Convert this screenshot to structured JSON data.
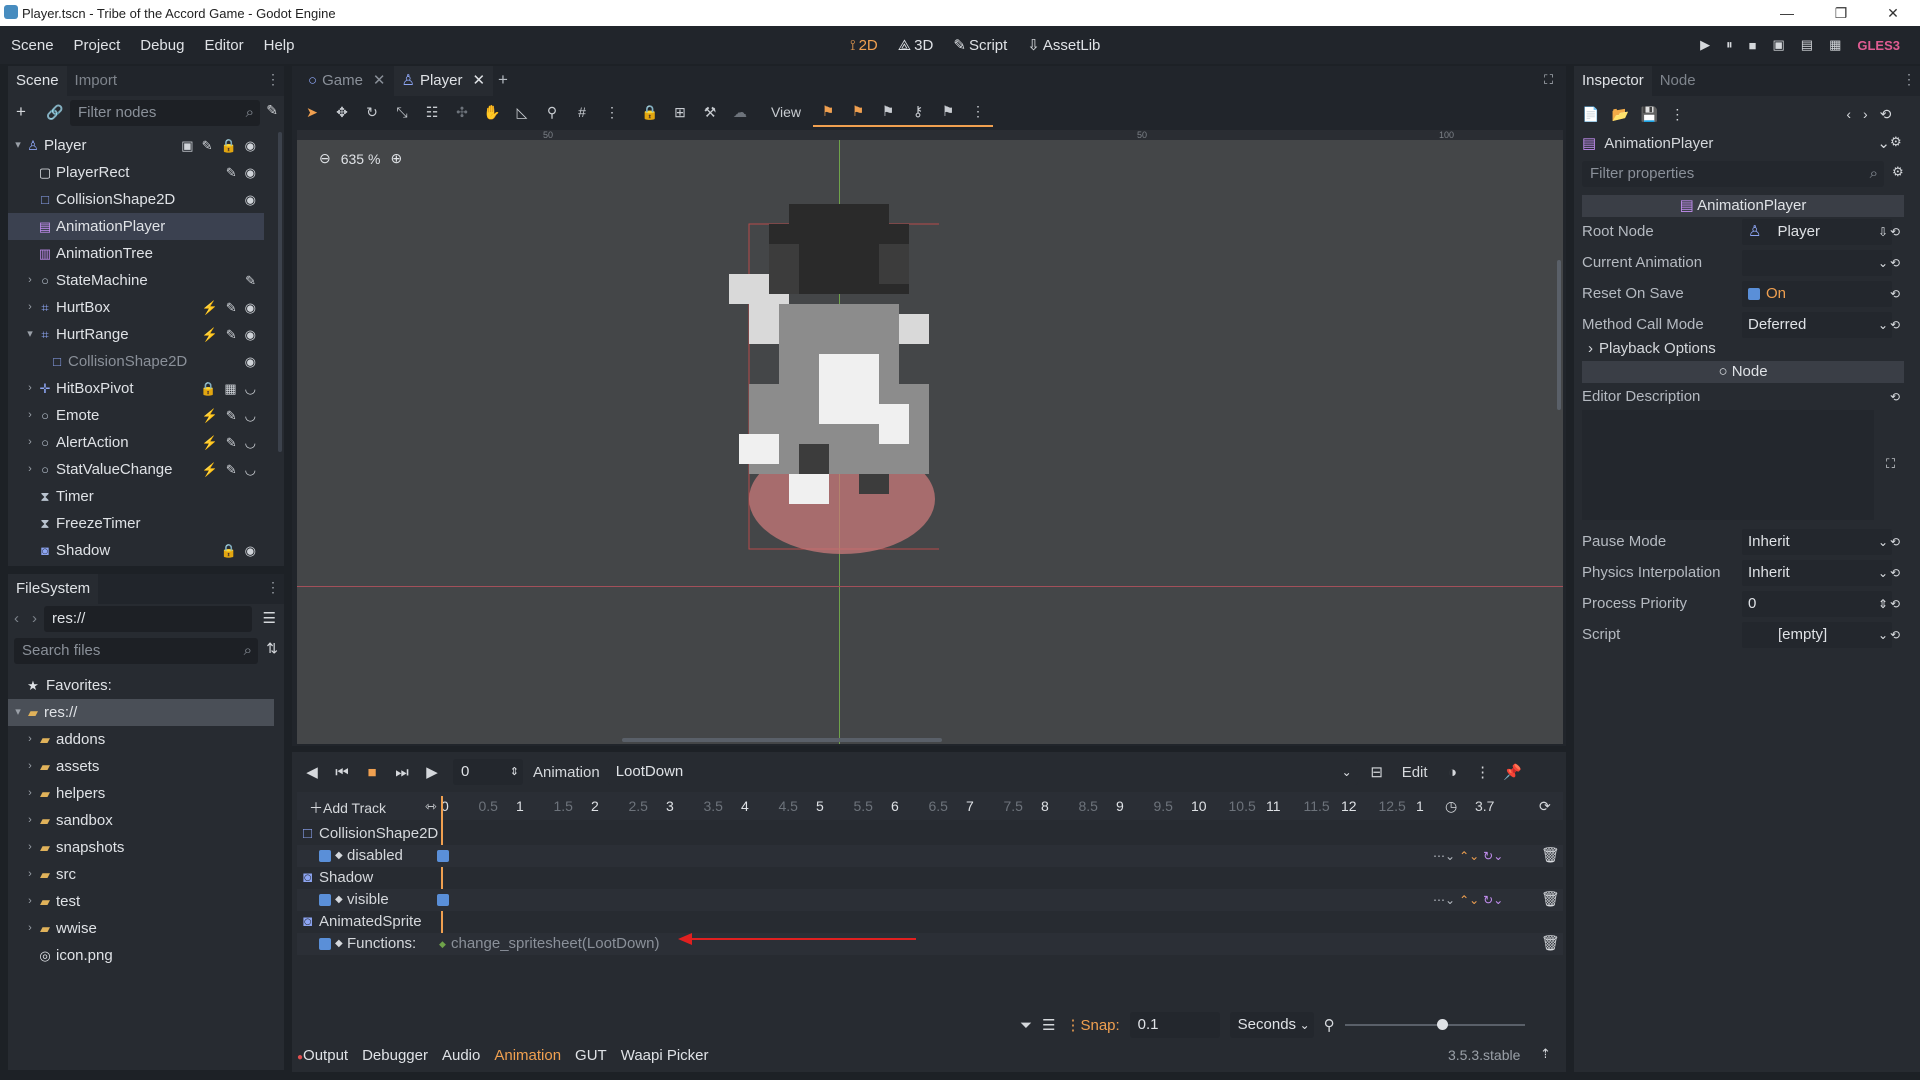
{
  "window": {
    "title": "Player.tscn - Tribe of the Accord Game - Godot Engine"
  },
  "menu": [
    "Scene",
    "Project",
    "Debug",
    "Editor",
    "Help"
  ],
  "modes": [
    {
      "label": "2D",
      "icon": "2d-icon",
      "active": true
    },
    {
      "label": "3D",
      "icon": "3d-icon",
      "active": false
    },
    {
      "label": "Script",
      "icon": "script-icon",
      "active": false
    },
    {
      "label": "AssetLib",
      "icon": "assetlib-icon",
      "active": false
    }
  ],
  "renderer": "GLES3",
  "scene_dock": {
    "tabs": [
      "Scene",
      "Import"
    ],
    "filter_placeholder": "Filter nodes",
    "nodes": [
      {
        "label": "Player",
        "depth": 0,
        "icon": "player-node-icon",
        "arrow": "▾"
      },
      {
        "label": "PlayerRect",
        "depth": 1,
        "icon": "rect-icon"
      },
      {
        "label": "CollisionShape2D",
        "depth": 1,
        "icon": "collision-shape-icon"
      },
      {
        "label": "AnimationPlayer",
        "depth": 1,
        "icon": "animation-player-icon",
        "selected": true
      },
      {
        "label": "AnimationTree",
        "depth": 1,
        "icon": "animation-tree-icon"
      },
      {
        "label": "StateMachine",
        "depth": 1,
        "icon": "node-icon",
        "arrow": "›"
      },
      {
        "label": "HurtBox",
        "depth": 1,
        "icon": "area-icon",
        "arrow": "›"
      },
      {
        "label": "HurtRange",
        "depth": 1,
        "icon": "area-icon",
        "arrow": "▾"
      },
      {
        "label": "CollisionShape2D",
        "depth": 2,
        "icon": "collision-shape-icon",
        "dim": true
      },
      {
        "label": "HitBoxPivot",
        "depth": 1,
        "icon": "pivot-icon",
        "arrow": "›"
      },
      {
        "label": "Emote",
        "depth": 1,
        "icon": "node-icon",
        "arrow": "›"
      },
      {
        "label": "AlertAction",
        "depth": 1,
        "icon": "node-icon",
        "arrow": "›"
      },
      {
        "label": "StatValueChange",
        "depth": 1,
        "icon": "node-icon",
        "arrow": "›"
      },
      {
        "label": "Timer",
        "depth": 1,
        "icon": "timer-icon"
      },
      {
        "label": "FreezeTimer",
        "depth": 1,
        "icon": "timer-icon"
      },
      {
        "label": "Shadow",
        "depth": 1,
        "icon": "sprite-icon"
      }
    ]
  },
  "filesystem": {
    "title": "FileSystem",
    "path": "res://",
    "search_placeholder": "Search files",
    "favorites": "Favorites:",
    "root": "res://",
    "items": [
      "addons",
      "assets",
      "helpers",
      "sandbox",
      "snapshots",
      "src",
      "test",
      "wwise",
      "icon.png"
    ]
  },
  "editor_tabs": [
    {
      "label": "Game",
      "active": false
    },
    {
      "label": "Player",
      "active": true
    }
  ],
  "viewport": {
    "zoom": "635 %",
    "view_menu": "View",
    "ruler_marks": [
      "50",
      "50",
      "100"
    ]
  },
  "animation": {
    "current_time": "0",
    "label": "Animation",
    "name": "LootDown",
    "edit": "Edit",
    "add_track": "Add Track",
    "timeline": [
      "0",
      "0.5",
      "1",
      "1.5",
      "2",
      "2.5",
      "3",
      "3.5",
      "4",
      "4.5",
      "5",
      "5.5",
      "6",
      "6.5",
      "7",
      "7.5",
      "8",
      "8.5",
      "9",
      "9.5",
      "10",
      "10.5",
      "11",
      "11.5",
      "12",
      "12.5",
      "1"
    ],
    "length": "3.7",
    "tracks": [
      {
        "node": "CollisionShape2D",
        "property": "disabled"
      },
      {
        "node": "Shadow",
        "property": "visible"
      },
      {
        "node": "AnimatedSprite",
        "property": "Functions:",
        "key": "change_spritesheet(LootDown)"
      }
    ],
    "snap_label": "Snap:",
    "snap_value": "0.1",
    "snap_unit": "Seconds"
  },
  "bottom_tabs": [
    "Output",
    "Debugger",
    "Audio",
    "Animation",
    "GUT",
    "Waapi Picker"
  ],
  "version": "3.5.3.stable",
  "inspector": {
    "tabs": [
      "Inspector",
      "Node"
    ],
    "object": "AnimationPlayer",
    "filter_placeholder": "Filter properties",
    "section_main": "AnimationPlayer",
    "props": [
      {
        "k": "Root Node",
        "v": "Player"
      },
      {
        "k": "Current Animation",
        "v": ""
      },
      {
        "k": "Reset On Save",
        "v": "On"
      },
      {
        "k": "Method Call Mode",
        "v": "Deferred"
      }
    ],
    "playback": "Playback Options",
    "section_node": "Node",
    "editor_desc": "Editor Description",
    "props2": [
      {
        "k": "Pause Mode",
        "v": "Inherit"
      },
      {
        "k": "Physics Interpolation",
        "v": "Inherit"
      },
      {
        "k": "Process Priority",
        "v": "0"
      },
      {
        "k": "Script",
        "v": "[empty]"
      }
    ]
  }
}
